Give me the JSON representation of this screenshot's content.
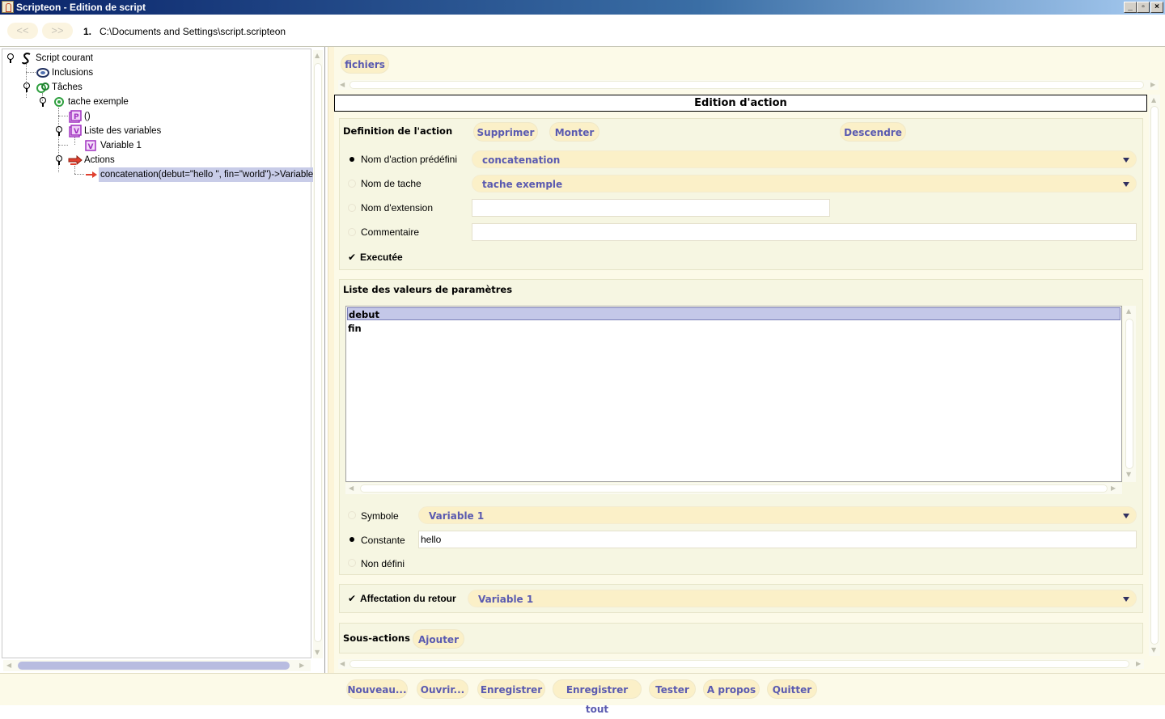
{
  "window": {
    "title": "Scripteon - Edition de script",
    "controls": [
      "minimize",
      "maximize",
      "close"
    ]
  },
  "history": {
    "back_label": "<<",
    "forward_label": ">>",
    "index": "1.",
    "path": "C:\\Documents and Settings\\script.scripteon"
  },
  "tree": {
    "root": "Script courant",
    "inclusions": "Inclusions",
    "taches": "Tâches",
    "task": "tache exemple",
    "params": "()",
    "vars": "Liste des variables",
    "var1": "Variable 1",
    "actions": "Actions",
    "action1": "concatenation(debut=\"hello \", fin=\"world\")->Variable"
  },
  "tabs": {
    "fichiers": "fichiers"
  },
  "editor": {
    "header": "Edition d'action",
    "definition": {
      "title": "Definition de l'action",
      "supprimer": "Supprimer",
      "monter": "Monter",
      "descendre": "Descendre",
      "predef_label": "Nom d'action prédéfini",
      "predef_value": "concatenation",
      "tache_label": "Nom de tache",
      "tache_value": "tache exemple",
      "extension_label": "Nom d'extension",
      "extension_value": "",
      "commentaire_label": "Commentaire",
      "commentaire_value": "",
      "executee_label": "Executée",
      "executee_checked": true
    },
    "params": {
      "title": "Liste des valeurs de paramètres",
      "items": [
        "debut",
        "fin"
      ],
      "selected": "debut",
      "symbole_label": "Symbole",
      "symbole_value": "Variable 1",
      "constante_label": "Constante",
      "constante_value": "hello",
      "nondefini_label": "Non défini"
    },
    "retour": {
      "label": "Affectation du retour",
      "checked": true,
      "value": "Variable 1"
    },
    "sous_actions": {
      "title": "Sous-actions",
      "ajouter": "Ajouter"
    }
  },
  "footer": {
    "nouveau": "Nouveau...",
    "ouvrir": "Ouvrir...",
    "enregistrer": "Enregistrer",
    "enregistrer_tout": "Enregistrer tout",
    "tester": "Tester",
    "apropos": "A propos",
    "quitter": "Quitter"
  },
  "colors": {
    "accent_text": "#5a5ab0",
    "pill_bg": "#fbf0c8",
    "panel_bg": "#f6f6e2",
    "selection": "#c4c8e8"
  }
}
